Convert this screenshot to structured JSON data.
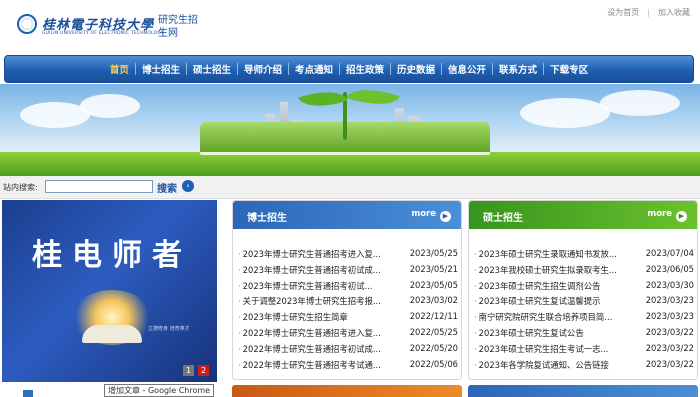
{
  "header": {
    "logo_cn": "桂林電子科技大學",
    "logo_en": "GUILIN UNIVERSITY OF ELECTRONIC TECHNOLOGY",
    "logo_sub": "研究生招生网",
    "top_links": [
      "设为首页",
      "加入收藏"
    ]
  },
  "nav": {
    "items": [
      "首页",
      "博士招生",
      "硕士招生",
      "导师介绍",
      "考点通知",
      "招生政策",
      "历史数据",
      "信息公开",
      "联系方式",
      "下载专区"
    ],
    "active_index": 0
  },
  "search": {
    "label": "站内搜索:",
    "value": "",
    "button": "搜索",
    "arrow": "›"
  },
  "slide": {
    "title": "桂电师者",
    "caption": "立德修身 培育英才",
    "pages": [
      "1",
      "2"
    ],
    "active_page": 2
  },
  "panels": {
    "phd": {
      "title": "博士招生",
      "more": "more",
      "color": "#2f6fbf",
      "items": [
        {
          "title": "2023年博士研究生普通招考进入复...",
          "date": "2023/05/25"
        },
        {
          "title": "2023年博士研究生普通招考初试成...",
          "date": "2023/05/21"
        },
        {
          "title": "2023年博士研究生普通招考初试...",
          "date": "2023/05/05"
        },
        {
          "title": "关于调整2023年博士研究生招考报...",
          "date": "2023/03/02"
        },
        {
          "title": "2023年博士研究生招生简章",
          "date": "2022/12/11"
        },
        {
          "title": "2022年博士研究生普通招考进入复...",
          "date": "2022/05/25"
        },
        {
          "title": "2022年博士研究生普通招考初试成...",
          "date": "2022/05/20"
        },
        {
          "title": "2022年博士研究生普通招考考试通...",
          "date": "2022/05/06"
        }
      ]
    },
    "master": {
      "title": "硕士招生",
      "more": "more",
      "color": "#3d9f24",
      "items": [
        {
          "title": "2023年硕士研究生录取通知书发放...",
          "date": "2023/07/04"
        },
        {
          "title": "2023年我校硕士研究生拟录取考生...",
          "date": "2023/06/05"
        },
        {
          "title": "2023年硕士研究生招生调剂公告",
          "date": "2023/03/30"
        },
        {
          "title": "2023年硕士研究生复试温馨提示",
          "date": "2023/03/23"
        },
        {
          "title": "南宁研究院研究生联合培养项目简...",
          "date": "2023/03/23"
        },
        {
          "title": "2023年硕士研究生复试公告",
          "date": "2023/03/22"
        },
        {
          "title": "2023年硕士研究生招生考试一志...",
          "date": "2023/03/22"
        },
        {
          "title": "2023年各学院复试通知、公告链接",
          "date": "2023/03/22"
        }
      ]
    }
  },
  "tooltip": "增加文章 - Google Chrome"
}
